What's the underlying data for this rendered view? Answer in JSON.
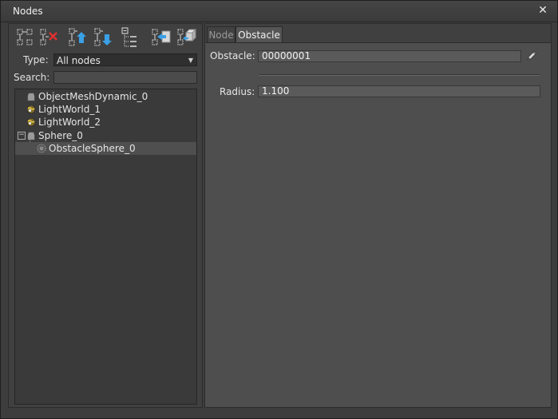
{
  "window": {
    "title": "Nodes",
    "close_glyph": "✕"
  },
  "toolbar": {
    "buttons": [
      {
        "icon": "clone-node-icon"
      },
      {
        "icon": "delete-node-icon"
      },
      {
        "icon": "move-up-icon"
      },
      {
        "icon": "move-down-icon"
      },
      {
        "icon": "expand-tree-icon"
      },
      {
        "icon": "import-node-icon"
      },
      {
        "icon": "export-node-icon"
      }
    ]
  },
  "filter": {
    "type_label": "Type:",
    "type_value": "All nodes",
    "search_label": "Search:",
    "search_value": ""
  },
  "tree": {
    "items": [
      {
        "label": "ObjectMeshDynamic_0",
        "icon": "mesh-icon",
        "depth": 0,
        "selected": false
      },
      {
        "label": "LightWorld_1",
        "icon": "light-world-icon",
        "depth": 0,
        "selected": false
      },
      {
        "label": "LightWorld_2",
        "icon": "light-world-icon",
        "depth": 0,
        "selected": false
      },
      {
        "label": "Sphere_0",
        "icon": "mesh-icon",
        "depth": 0,
        "selected": false,
        "expanded": true,
        "expander": "−"
      },
      {
        "label": "ObstacleSphere_0",
        "icon": "obstacle-icon",
        "depth": 1,
        "selected": true
      }
    ]
  },
  "tabs": [
    {
      "label": "Node",
      "active": false
    },
    {
      "label": "Obstacle",
      "active": true
    }
  ],
  "obstacle": {
    "obstacle_label": "Obstacle:",
    "obstacle_value": "00000001",
    "radius_label": "Radius:",
    "radius_value": "1.100"
  },
  "colors": {
    "background": "#3d3d3d",
    "panel": "#404040",
    "tab_body": "#4e4e4e",
    "selection": "#4f4f4f",
    "accent_blue": "#3aa0e6"
  }
}
